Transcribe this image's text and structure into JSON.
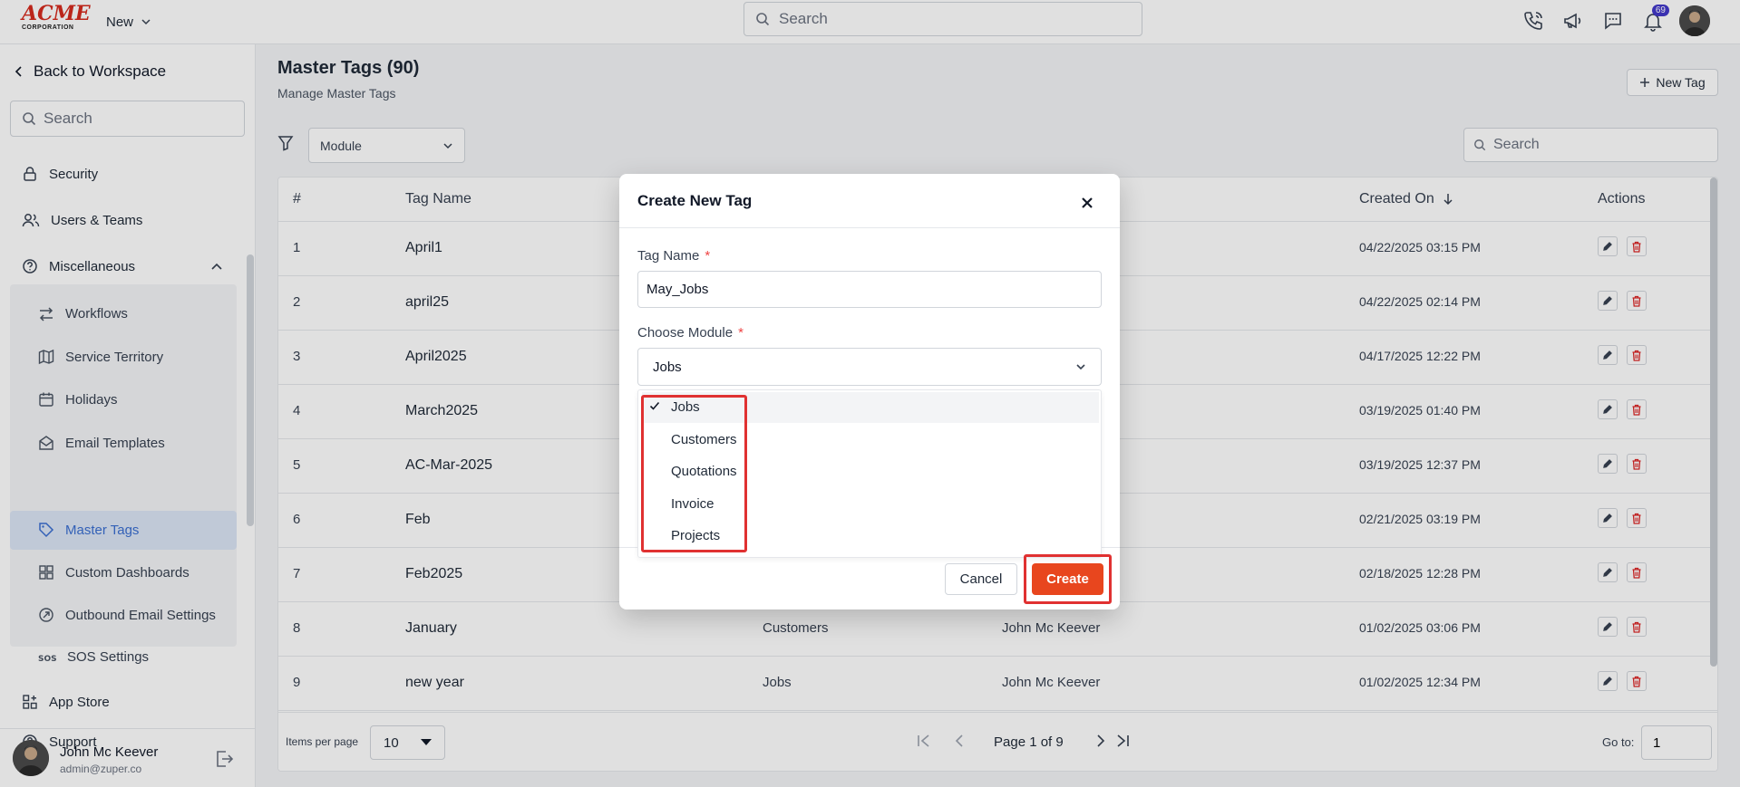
{
  "topbar": {
    "logo_main": "ACME",
    "logo_sub": "CORPORATION",
    "new_label": "New",
    "search_placeholder": "Search",
    "notification_count": "69",
    "icons": [
      "phone-icon",
      "megaphone-icon",
      "chat-icon",
      "bell-icon"
    ]
  },
  "sidebar": {
    "back_label": "Back to Workspace",
    "search_placeholder": "Search",
    "items": [
      {
        "label": "Security",
        "icon": "lock-icon"
      },
      {
        "label": "Users & Teams",
        "icon": "users-icon"
      },
      {
        "label": "Miscellaneous",
        "icon": "help-circle-icon"
      }
    ],
    "sub_items": [
      {
        "label": "Workflows",
        "icon": "arrows-icon"
      },
      {
        "label": "Service Territory",
        "icon": "map-icon"
      },
      {
        "label": "Holidays",
        "icon": "calendar-icon"
      },
      {
        "label": "Email Templates",
        "icon": "mail-open-icon"
      },
      {
        "label": "Master Tags",
        "icon": "tag-icon",
        "active": true
      },
      {
        "label": "Custom Dashboards",
        "icon": "dashboard-icon"
      },
      {
        "label": "Outbound Email Settings",
        "icon": "send-circle-icon"
      },
      {
        "label": "SOS Settings",
        "icon": "sos-icon"
      }
    ],
    "bottom_items": [
      {
        "label": "App Store",
        "icon": "apps-icon"
      },
      {
        "label": "Support",
        "icon": "help-circle-icon"
      }
    ],
    "user": {
      "name": "John Mc Keever",
      "email": "admin@zuper.co"
    }
  },
  "main": {
    "title": "Master Tags (90)",
    "subtitle": "Manage Master Tags",
    "new_tag_label": "New Tag",
    "module_filter": "Module",
    "search_placeholder": "Search",
    "columns": {
      "num": "#",
      "tag_name": "Tag Name",
      "created_on": "Created On",
      "actions": "Actions"
    },
    "rows": [
      {
        "num": "1",
        "name": "April1",
        "module": "",
        "created_by": "",
        "created_on": "04/22/2025 03:15 PM"
      },
      {
        "num": "2",
        "name": "april25",
        "module": "",
        "created_by": "",
        "created_on": "04/22/2025 02:14 PM"
      },
      {
        "num": "3",
        "name": "April2025",
        "module": "",
        "created_by": "",
        "created_on": "04/17/2025 12:22 PM"
      },
      {
        "num": "4",
        "name": "March2025",
        "module": "",
        "created_by": "",
        "created_on": "03/19/2025 01:40 PM"
      },
      {
        "num": "5",
        "name": "AC-Mar-2025",
        "module": "",
        "created_by": "",
        "created_on": "03/19/2025 12:37 PM"
      },
      {
        "num": "6",
        "name": "Feb",
        "module": "",
        "created_by": "",
        "created_on": "02/21/2025 03:19 PM"
      },
      {
        "num": "7",
        "name": "Feb2025",
        "module": "",
        "created_by": "",
        "created_on": "02/18/2025 12:28 PM"
      },
      {
        "num": "8",
        "name": "January",
        "module": "Customers",
        "created_by": "John Mc Keever",
        "created_on": "01/02/2025 03:06 PM"
      },
      {
        "num": "9",
        "name": "new year",
        "module": "Jobs",
        "created_by": "John Mc Keever",
        "created_on": "01/02/2025 12:34 PM"
      }
    ],
    "pagination": {
      "items_per_page_label": "Items per page",
      "items_per_page": "10",
      "page_label": "Page 1 of 9",
      "goto_label": "Go to:",
      "goto_value": "1"
    }
  },
  "modal": {
    "title": "Create New Tag",
    "tag_name_label": "Tag Name",
    "required_mark": "*",
    "tag_name_value": "May_Jobs",
    "module_label": "Choose Module",
    "module_value": "Jobs",
    "options": [
      "Jobs",
      "Customers",
      "Quotations",
      "Invoice",
      "Projects"
    ],
    "selected_option": "Jobs",
    "cancel_label": "Cancel",
    "create_label": "Create"
  },
  "colors": {
    "brand_red": "#d52b1e",
    "primary_orange": "#e8461e",
    "active_blue": "#3b6fd1",
    "highlight_red": "#e03131",
    "delete_red": "#dc2626"
  }
}
